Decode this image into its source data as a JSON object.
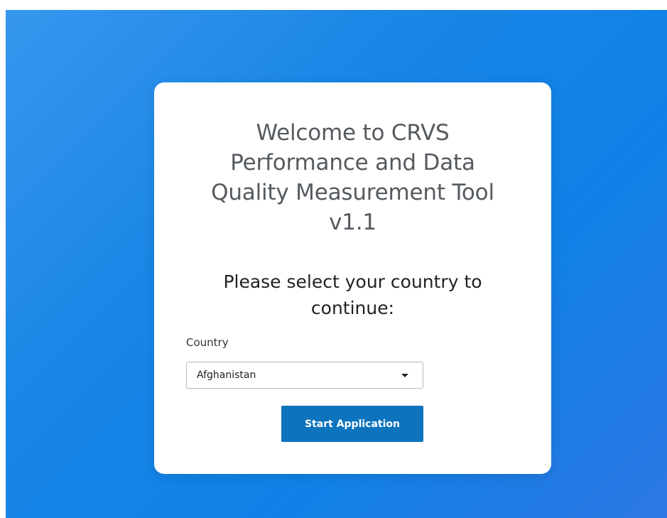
{
  "card": {
    "title_lines": [
      "Welcome to CRVS",
      "Performance and Data",
      "Quality Measurement Tool",
      "v1.1"
    ],
    "subtitle_lines": [
      "Please select your country to",
      "continue:"
    ]
  },
  "country_field": {
    "label": "Country",
    "selected_value": "Afghanistan",
    "caret_icon": "chevron-down-icon"
  },
  "start_button": {
    "label": "Start Application",
    "color": "#0d73bd"
  },
  "colors": {
    "background_gradient_start": "#3797ee",
    "background_gradient_end": "#2c77e3",
    "card": "#ffffff"
  }
}
